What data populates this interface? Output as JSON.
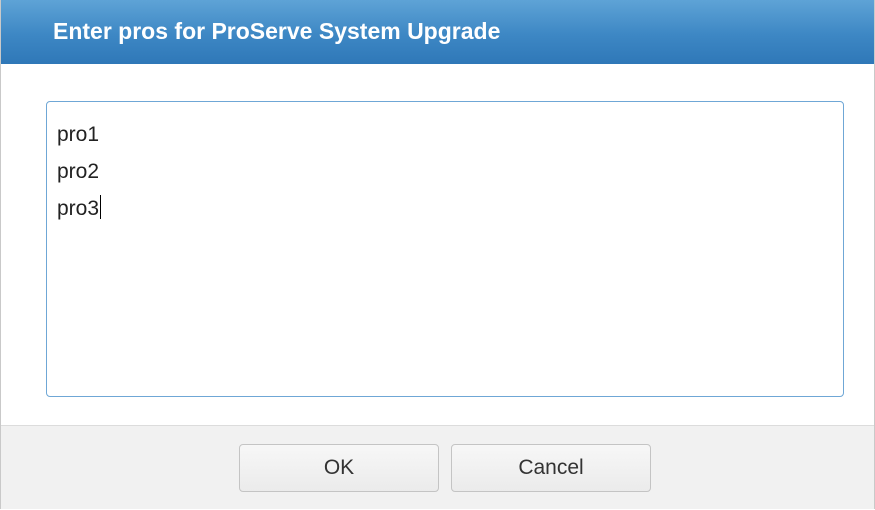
{
  "dialog": {
    "title": "Enter pros for ProServe System Upgrade",
    "textarea_lines": [
      "pro1",
      "pro2",
      "pro3"
    ],
    "ok_label": "OK",
    "cancel_label": "Cancel"
  }
}
